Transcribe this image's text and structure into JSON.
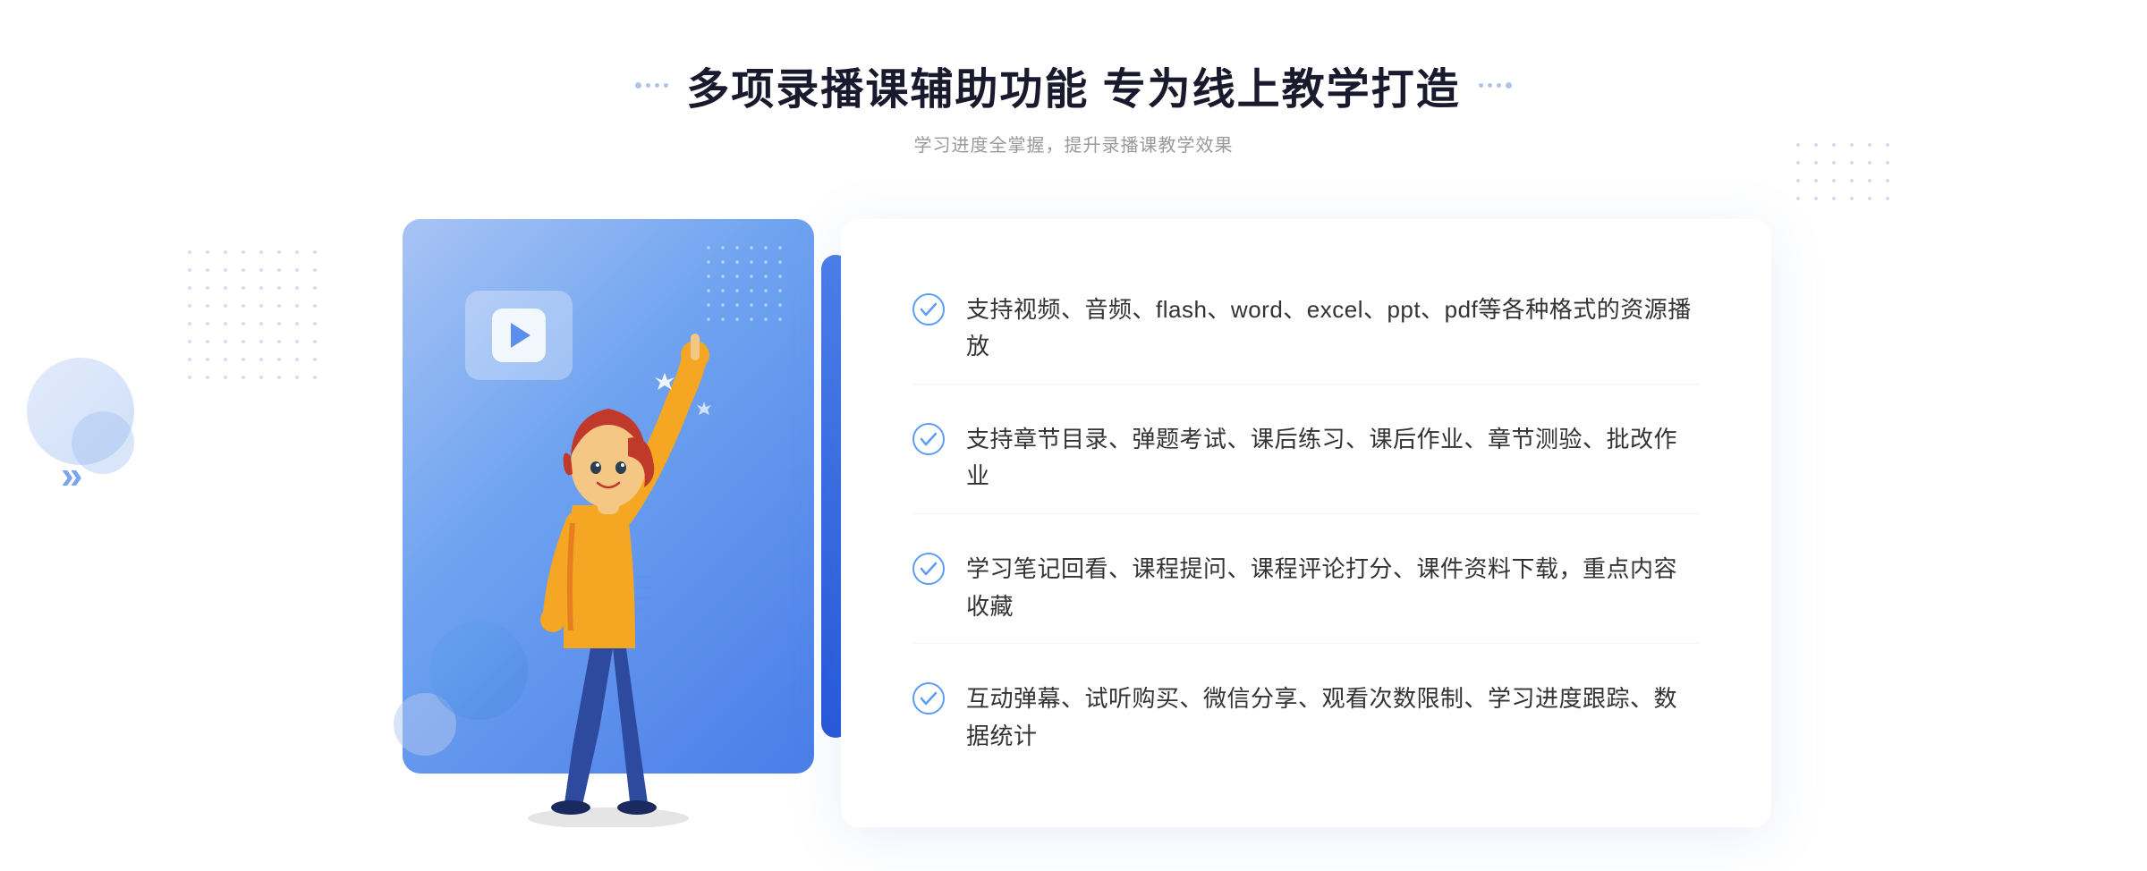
{
  "header": {
    "title": "多项录播课辅助功能 专为线上教学打造",
    "subtitle": "学习进度全掌握，提升录播课教学效果",
    "decoration_dots": "··· ···"
  },
  "features": [
    {
      "id": 1,
      "text": "支持视频、音频、flash、word、excel、ppt、pdf等各种格式的资源播放"
    },
    {
      "id": 2,
      "text": "支持章节目录、弹题考试、课后练习、课后作业、章节测验、批改作业"
    },
    {
      "id": 3,
      "text": "学习笔记回看、课程提问、课程评论打分、课件资料下载，重点内容收藏"
    },
    {
      "id": 4,
      "text": "互动弹幕、试听购买、微信分享、观看次数限制、学习进度跟踪、数据统计"
    }
  ],
  "colors": {
    "primary_blue": "#4a7de8",
    "light_blue": "#a8c4f5",
    "text_dark": "#1a1a2e",
    "text_gray": "#999999",
    "text_normal": "#333333",
    "check_color": "#5b9cf6"
  }
}
